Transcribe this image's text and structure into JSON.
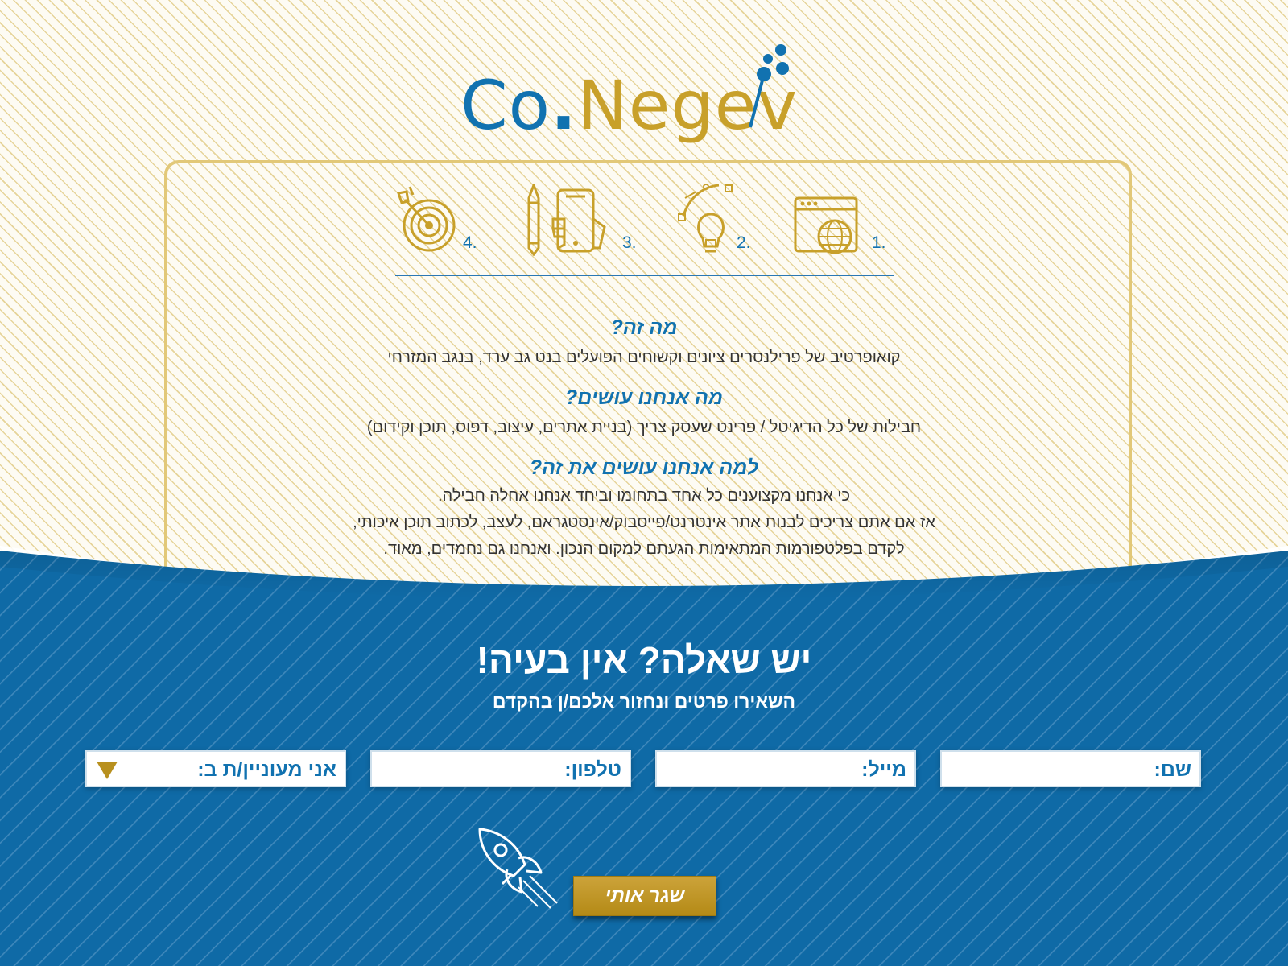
{
  "logo": {
    "prefix": "Co",
    "dot": ".",
    "name": "Negev"
  },
  "steps": [
    {
      "number": "1.",
      "icon": "web-globe-icon"
    },
    {
      "number": "2.",
      "icon": "lightbulb-vector-icon"
    },
    {
      "number": "3.",
      "icon": "pencil-phone-icon"
    },
    {
      "number": "4.",
      "icon": "target-icon"
    }
  ],
  "about": {
    "q1": "מה זה?",
    "a1": "קואופרטיב של פרילנסרים ציונים וקשוחים הפועלים בנט גב ערד, בנגב המזרחי",
    "q2": "מה אנחנו עושים?",
    "a2": "חבילות של כל הדיגיטל / פרינט שעסק צריך (בניית אתרים, עיצוב, דפוס, תוכן וקידום)",
    "q3": "למה אנחנו עושים את זה?",
    "a3_line1": "כי אנחנו מקצוענים כל אחד בתחומו וביחד אנחנו אחלה חבילה.",
    "a3_line2": "אז אם אתם צריכים לבנות אתר אינטרנט/פייסבוק/אינסטגראם, לעצב, לכתוב תוכן איכותי,",
    "a3_line3": "לקדם בפלטפורמות המתאימות הגעתם למקום הנכון. ואנחנו גם נחמדים, מאוד."
  },
  "contact": {
    "title": "יש שאלה? אין בעיה!",
    "subtitle": "השאירו פרטים ונחזור אלכם/ן בהקדם",
    "fields": {
      "name": "שם:",
      "email": "מייל:",
      "phone": "טלפון:",
      "interest": "אני מעוניין/ת ב:"
    },
    "submit": "שגר אותי"
  },
  "colors": {
    "brand_blue": "#1172b0",
    "brand_gold": "#c8a02a",
    "section_blue": "#0f6aa6"
  }
}
